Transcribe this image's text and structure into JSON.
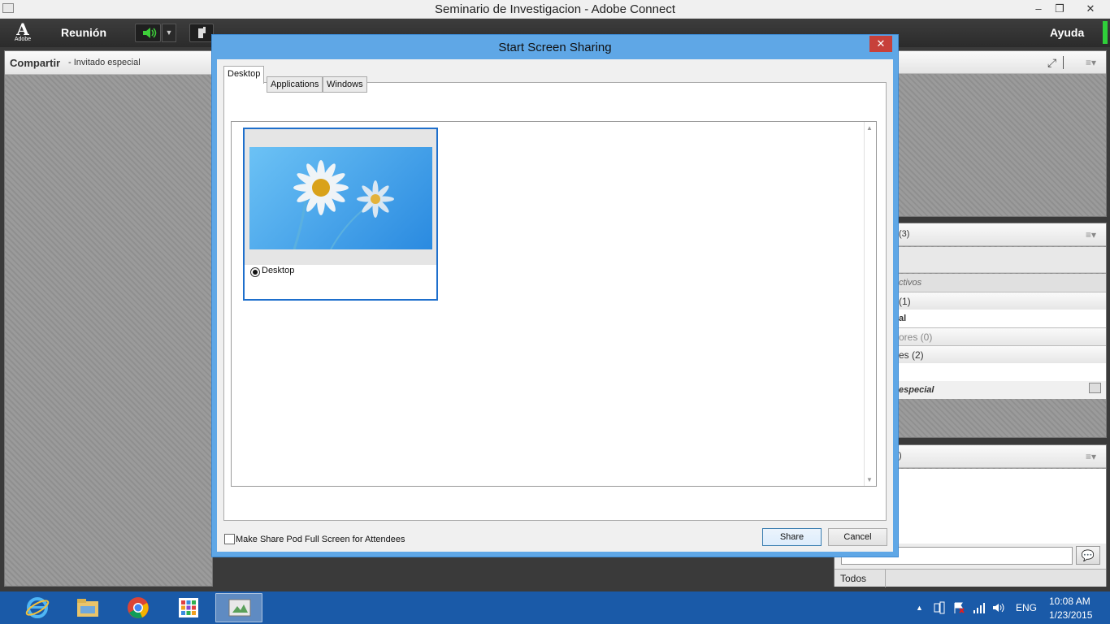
{
  "window": {
    "title": "Seminario de Investigacion - Adobe Connect",
    "minimize": "–",
    "restore": "❐",
    "close": "✕"
  },
  "menubar": {
    "logo_text": "Adobe",
    "meeting_menu": "Reunión",
    "help_menu": "Ayuda"
  },
  "share_pod": {
    "title": "Compartir",
    "subtitle": "- Invitado especial"
  },
  "attendees_pod": {
    "count_label": "(3)",
    "group_active_label": "ctivos",
    "hosts_label": "(1)",
    "host_name": "al",
    "presenters_label": "ores (0)",
    "participants_label": "es (2)",
    "guest_name": "especial"
  },
  "chat_pod": {
    "title_fragment": ")",
    "recipient": "Todos"
  },
  "dialog": {
    "title": "Start Screen Sharing",
    "close": "✕",
    "tabs": [
      "Desktop",
      "Applications",
      "Windows"
    ],
    "selected_tab": "Desktop",
    "desktop_option": "Desktop",
    "fullscreen_checkbox": "Make Share Pod Full Screen for Attendees",
    "fullscreen_checked": false,
    "share_button": "Share",
    "cancel_button": "Cancel"
  },
  "taskbar": {
    "apps": [
      "internet-explorer-icon",
      "file-explorer-icon",
      "chrome-icon",
      "apps-icon",
      "adobe-connect-icon"
    ],
    "language": "ENG",
    "time": "10:08 AM",
    "date": "1/23/2015"
  },
  "colors": {
    "accent_blue": "#1e6fcc",
    "dialog_frame": "#5fa7e6",
    "close_red": "#c7403a",
    "taskbar": "#1a5aa8",
    "speaker_green": "#3ecf3a"
  }
}
